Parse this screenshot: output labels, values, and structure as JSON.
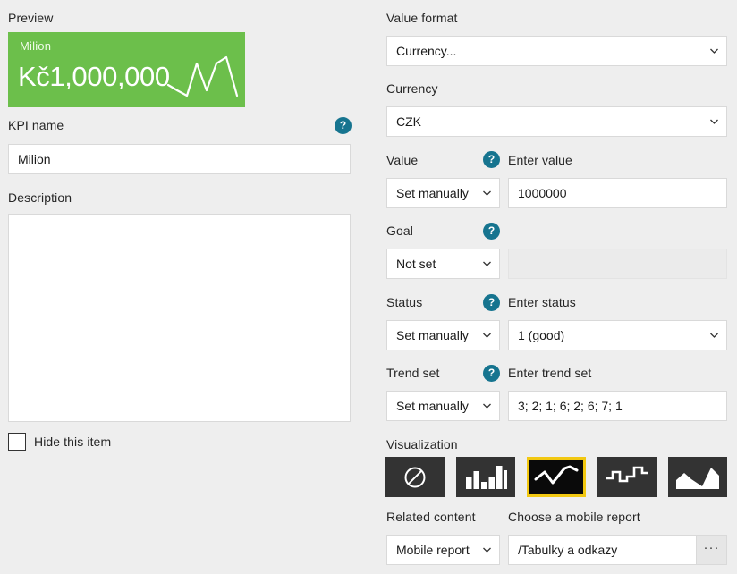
{
  "left": {
    "preview_label": "Preview",
    "preview_tile": {
      "name": "Milion",
      "value": "Kč1,000,000",
      "background_color": "#6cbf4b",
      "sparkline_color": "#ffffff"
    },
    "kpi_name_label": "KPI name",
    "kpi_name_value": "Milion",
    "kpi_name_placeholder": "",
    "description_label": "Description",
    "description_value": "",
    "description_placeholder": "",
    "hide_item_label": "Hide this item",
    "hide_item_checked": false,
    "help_glyph": "?"
  },
  "right": {
    "value_format_label": "Value format",
    "value_format_value": "Currency...",
    "currency_label": "Currency",
    "currency_value": "CZK",
    "value_label": "Value",
    "value_sub_label": "Enter value",
    "value_mode": "Set manually",
    "value_entry": "1000000",
    "value_entry_placeholder": "",
    "goal_label": "Goal",
    "goal_mode": "Not set",
    "goal_entry": "",
    "goal_entry_placeholder": "",
    "status_label": "Status",
    "status_sub_label": "Enter status",
    "status_mode": "Set manually",
    "status_entry": "1 (good)",
    "trend_label": "Trend set",
    "trend_sub_label": "Enter trend set",
    "trend_mode": "Set manually",
    "trend_entry": "3; 2; 1; 6; 2; 6; 7; 1",
    "trend_entry_placeholder": "",
    "visualization_label": "Visualization",
    "visualizations": [
      {
        "name": "none",
        "icon": "no-chart-icon",
        "selected": false
      },
      {
        "name": "bar",
        "icon": "bar-chart-icon",
        "selected": false
      },
      {
        "name": "line",
        "icon": "line-chart-icon",
        "selected": true
      },
      {
        "name": "step",
        "icon": "step-chart-icon",
        "selected": false
      },
      {
        "name": "area",
        "icon": "area-chart-icon",
        "selected": false
      }
    ],
    "selected_visualization_color": "#f2c811",
    "related_content_label": "Related content",
    "related_content_value": "Mobile report",
    "mobile_report_sub_label": "Choose a mobile report",
    "mobile_report_value": "/Tabulky a odkazy",
    "mobile_report_placeholder": "",
    "browse_button_label": "···"
  },
  "chart_data": {
    "type": "line",
    "title": "Milion",
    "x": [
      1,
      2,
      3,
      4,
      5,
      6,
      7,
      8
    ],
    "values": [
      3,
      2,
      1,
      6,
      2,
      6,
      7,
      1
    ],
    "xlabel": "",
    "ylabel": "",
    "ylim": [
      1,
      7
    ],
    "grid": false,
    "legend": "none",
    "annotations": [
      "Kč1,000,000"
    ]
  }
}
